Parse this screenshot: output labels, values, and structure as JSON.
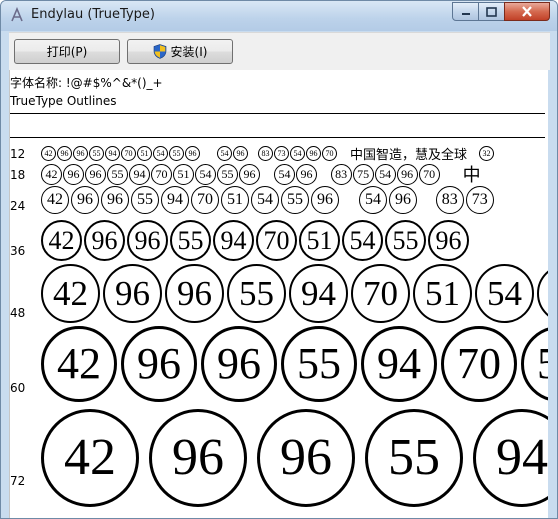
{
  "window": {
    "title": "Endylau (TrueType)",
    "controls": {
      "minimize": "minimize",
      "maximize": "maximize",
      "close": "close"
    }
  },
  "toolbar": {
    "print_label": "打印(P)",
    "install_label": "安装(I)"
  },
  "font_info": {
    "name_line": "字体名称: !@#$%^&*()_+",
    "outline_line": "TrueType Outlines"
  },
  "samples": {
    "digits": [
      "42",
      "96",
      "96",
      "55",
      "94",
      "70",
      "51",
      "54",
      "55",
      "96"
    ],
    "extra_digits": [
      "54",
      "96",
      "83",
      "73",
      "54",
      "96",
      "70"
    ],
    "row18_extra": [
      "54",
      "96",
      "83",
      "75",
      "54",
      "96",
      "70"
    ],
    "cjk_text": "中国智造，慧及全球",
    "cjk_partial": "中",
    "trailing_12": "32",
    "sizes": [
      {
        "size": "12"
      },
      {
        "size": "18"
      },
      {
        "size": "24"
      },
      {
        "size": "36"
      },
      {
        "size": "48"
      },
      {
        "size": "60"
      },
      {
        "size": "72"
      }
    ]
  },
  "colors": {
    "frame": "#c9dcef",
    "close_button": "#c14128",
    "text": "#000000"
  }
}
